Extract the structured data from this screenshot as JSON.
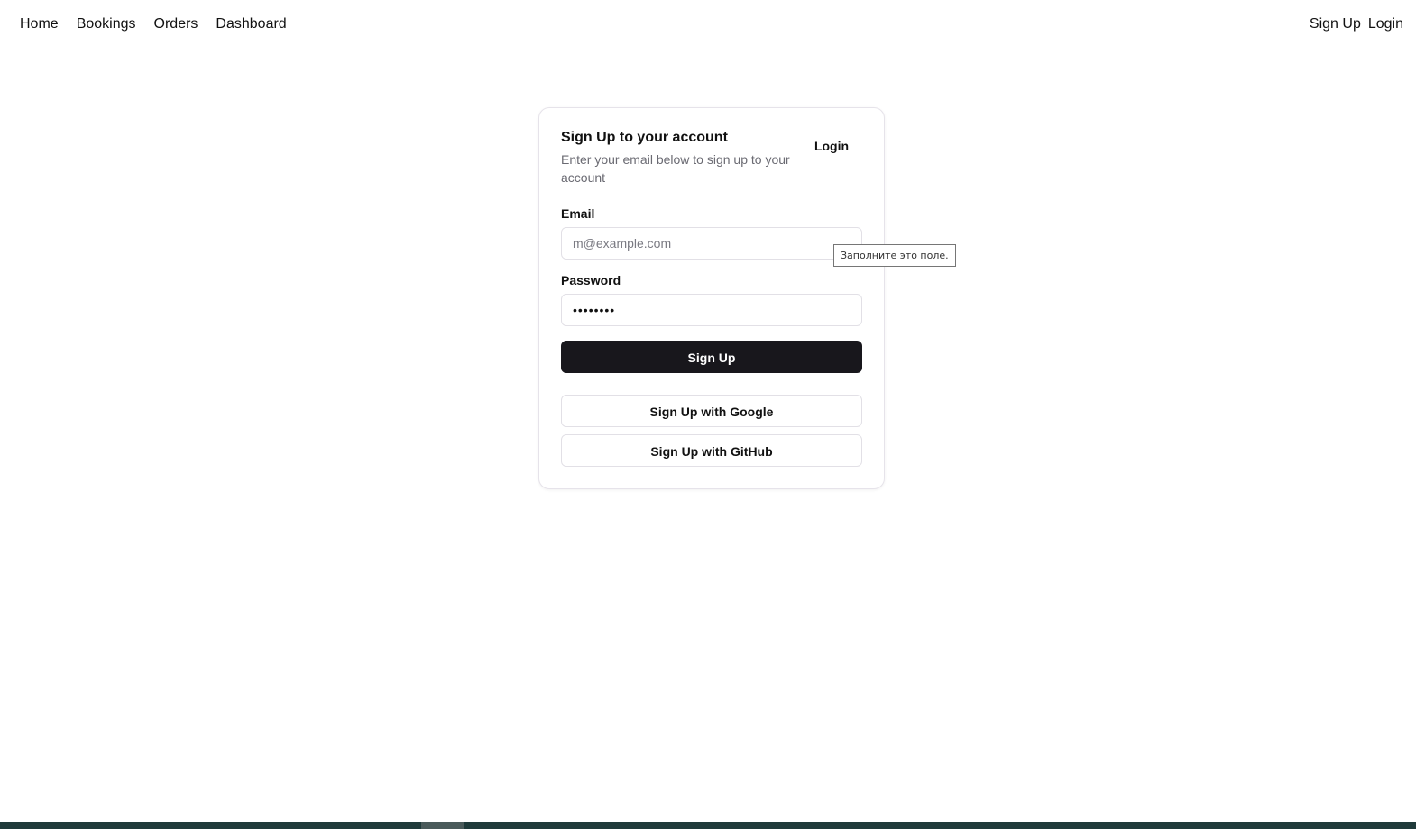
{
  "nav": {
    "left": [
      {
        "label": "Home"
      },
      {
        "label": "Bookings"
      },
      {
        "label": "Orders"
      },
      {
        "label": "Dashboard"
      }
    ],
    "right": [
      {
        "label": "Sign Up"
      },
      {
        "label": "Login"
      }
    ]
  },
  "card": {
    "title": "Sign Up to your account",
    "description": "Enter your email below to sign up to your account",
    "login_link": "Login",
    "email": {
      "label": "Email",
      "placeholder": "m@example.com",
      "value": ""
    },
    "password": {
      "label": "Password",
      "value": "••••••••"
    },
    "submit_label": "Sign Up",
    "google_label": "Sign Up with Google",
    "github_label": "Sign Up with GitHub"
  },
  "tooltip": {
    "text": "Заполните это поле."
  }
}
